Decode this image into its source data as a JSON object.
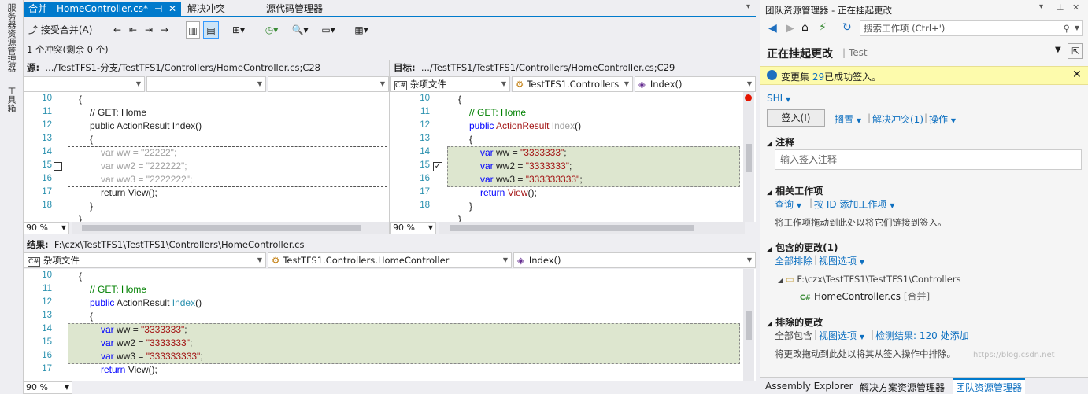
{
  "sidebar": {
    "server_explorer": "服务器资源管理器",
    "toolbox": "工具箱"
  },
  "tabs": {
    "active": "合并 - HomeController.cs*",
    "active_pin": "⊣",
    "active_close": "✕",
    "resolve": "解决冲突",
    "source_control": "源代码管理器"
  },
  "toolbar": {
    "accept_merge": "接受合并(A)"
  },
  "status": {
    "conflicts": "1 个冲突(剩余 0 个)"
  },
  "source": {
    "label": "源:",
    "path": ".../TestTFS1-分支/TestTFS1/Controllers/HomeController.cs;C28",
    "zoom": "90 %",
    "lines": [
      "10",
      "11",
      "12",
      "13",
      "14",
      "15",
      "16",
      "17",
      "18"
    ]
  },
  "target": {
    "label": "目标:",
    "path": ".../TestTFS1/TestTFS1/Controllers/HomeController.cs;C29",
    "combo1": "杂项文件",
    "combo2": "TestTFS1.Controllers",
    "combo3": "Index()",
    "zoom": "90 %",
    "lines": [
      "10",
      "11",
      "12",
      "13",
      "14",
      "15",
      "16",
      "17",
      "18"
    ]
  },
  "result": {
    "label": "结果:",
    "path": "F:\\czx\\TestTFS1\\TestTFS1\\Controllers\\HomeController.cs",
    "combo1": "杂项文件",
    "combo2": "TestTFS1.Controllers.HomeController",
    "combo3": "Index()",
    "zoom": "90 %",
    "lines": [
      "10",
      "11",
      "12",
      "13",
      "14",
      "15",
      "16",
      "17"
    ]
  },
  "code": {
    "brace_open": "{",
    "comment": "// GET: Home",
    "public": "public",
    "actionresult": "ActionResult",
    "index": "Index",
    "parens": "()",
    "var": "var",
    "ww": "ww",
    "ww2": "ww2",
    "ww3": "ww3",
    "eq": " = ",
    "semi": ";",
    "src_ww": "\"22222\"",
    "src_ww2": "\"222222\"",
    "src_ww3": "\"2222222\"",
    "tgt_ww": "\"3333333\"",
    "tgt_ww2": "\"3333333\"",
    "tgt_ww3": "\"333333333\"",
    "return": "return",
    "view": "View",
    "view_tail": "();",
    "brace_close": "}"
  },
  "team_explorer": {
    "title": "团队资源管理器 - 正在挂起更改",
    "search_placeholder": "搜索工作项 (Ctrl+')",
    "heading": "正在挂起更改",
    "separator": "|",
    "project": "Test",
    "info_prefix": "变更集 ",
    "changeset": "29",
    "info_suffix": "已成功签入。",
    "user": "SHI",
    "checkin_button": "签入(I)",
    "shelve": "搁置",
    "resolve_conflicts": "解决冲突(1)",
    "actions": "操作",
    "comment_section": "注释",
    "comment_placeholder": "输入签入注释",
    "related_section": "相关工作项",
    "query": "查询",
    "add_by_id": "按 ID 添加工作项",
    "related_hint": "将工作项拖动到此处以将它们链接到签入。",
    "included_section": "包含的更改(1)",
    "exclude_all": "全部排除",
    "view_options": "视图选项",
    "folder": "F:\\czx\\TestTFS1\\TestTFS1\\Controllers",
    "file": "HomeController.cs",
    "file_status": "[合并]",
    "excluded_section": "排除的更改",
    "include_all": "全部包含",
    "view_options2": "视图选项",
    "detected": "检测结果: 120 处添加",
    "excluded_hint": "将更改拖动到此处以将其从签入操作中排除。"
  },
  "bottom_tabs": {
    "assembly": "Assembly Explorer",
    "solution": "解决方案资源管理器",
    "team": "团队资源管理器"
  },
  "watermark": "https://blog.csdn.net"
}
